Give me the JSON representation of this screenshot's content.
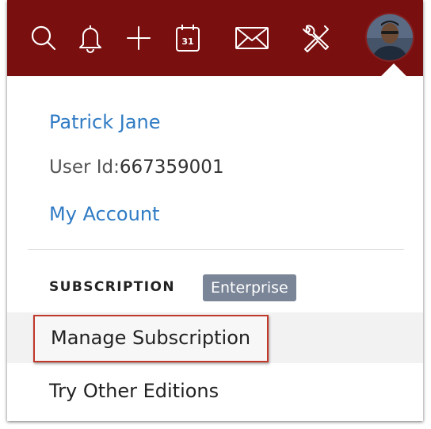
{
  "topbar": {
    "icons": [
      "search-icon",
      "bell-icon",
      "plus-icon",
      "calendar-icon",
      "mail-icon",
      "tools-icon"
    ],
    "calendar_day": "31",
    "color": "#7a0f0f"
  },
  "user": {
    "name": "Patrick Jane",
    "id_label": "User Id:",
    "id_value": "667359001"
  },
  "menu": {
    "my_account": "My Account",
    "subscription_label": "SUBSCRIPTION",
    "edition_badge": "Enterprise",
    "manage_subscription": "Manage Subscription",
    "try_other_editions": "Try Other Editions"
  },
  "colors": {
    "link": "#2f7bc4",
    "badge": "#7a8597",
    "highlight_border": "#c0392b"
  }
}
